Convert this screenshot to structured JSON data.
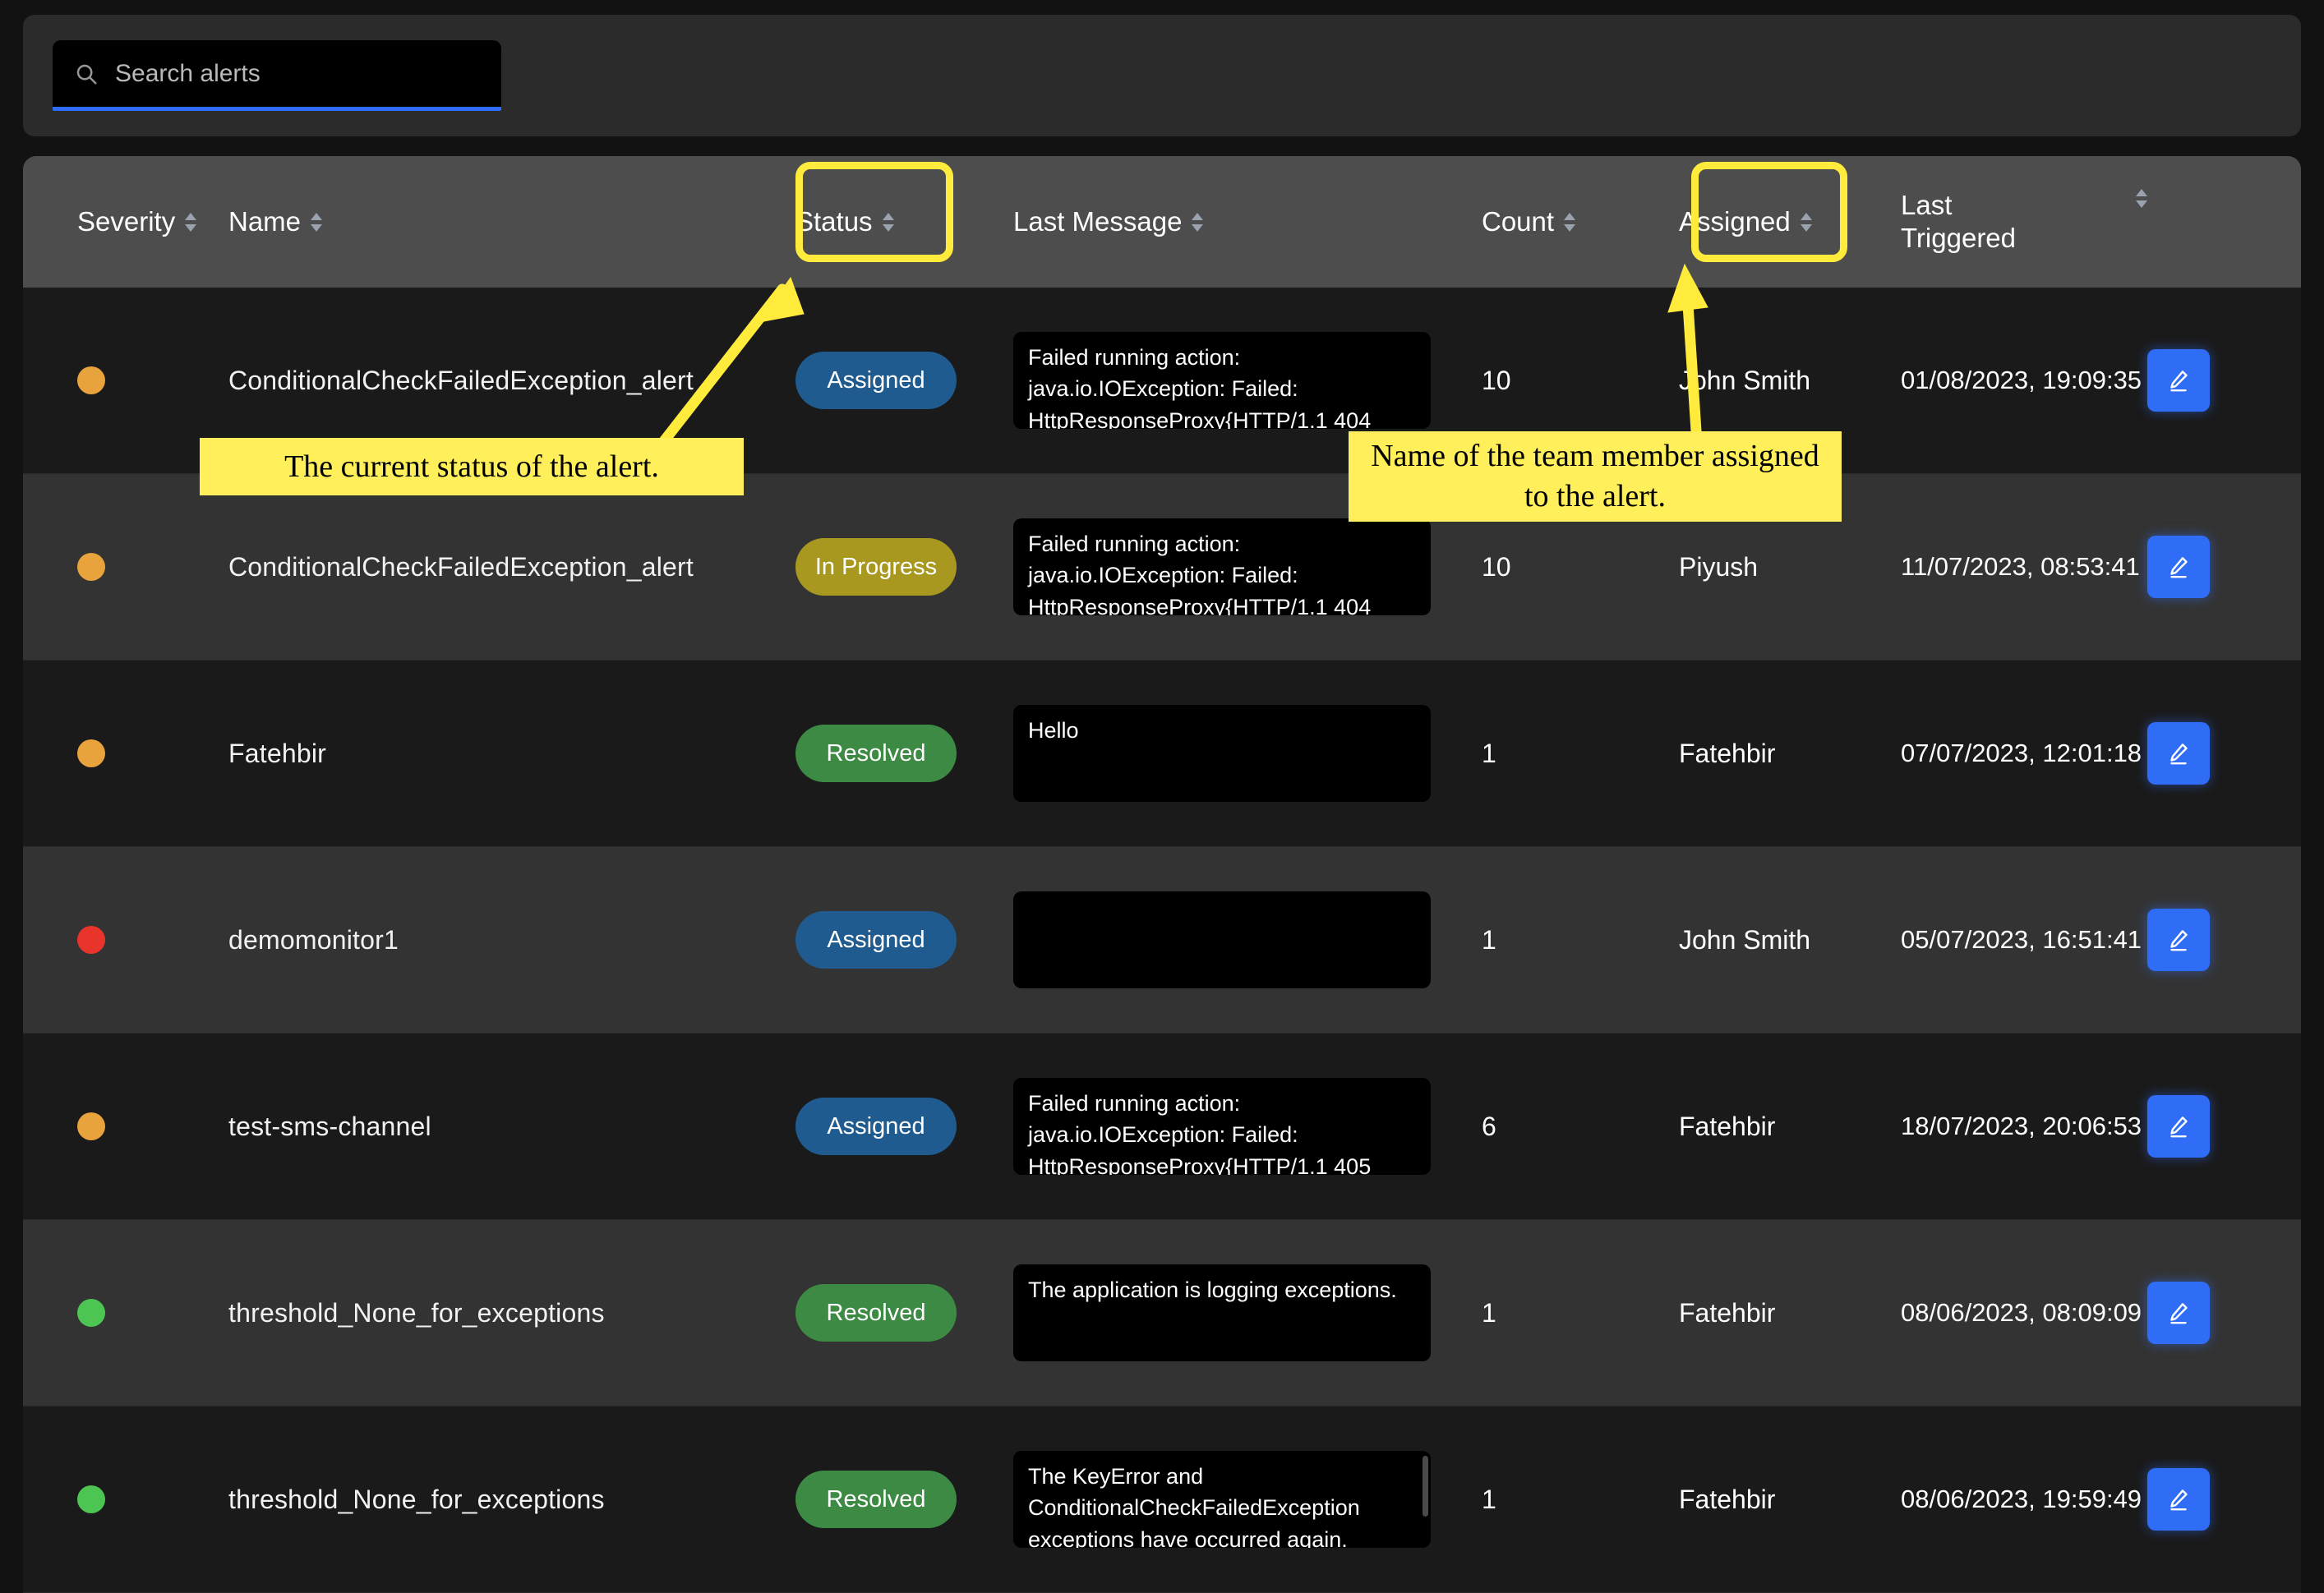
{
  "search": {
    "placeholder": "Search alerts",
    "value": "",
    "icon": "search-icon"
  },
  "table": {
    "columns": [
      {
        "key": "severity",
        "label": "Severity",
        "sortable": true
      },
      {
        "key": "name",
        "label": "Name",
        "sortable": true
      },
      {
        "key": "status",
        "label": "Status",
        "sortable": true
      },
      {
        "key": "message",
        "label": "Last Message",
        "sortable": true
      },
      {
        "key": "count",
        "label": "Count",
        "sortable": true
      },
      {
        "key": "assigned",
        "label": "Assigned",
        "sortable": true
      },
      {
        "key": "triggered",
        "label": "Last\nTriggered",
        "label_line1": "Last",
        "label_line2": "Triggered",
        "sortable": true
      },
      {
        "key": "actions",
        "label": "",
        "sortable": false
      }
    ],
    "rows": [
      {
        "severity_color": "#e8a33d",
        "severity_level": "warning",
        "name": "ConditionalCheckFailedException_alert",
        "status": "Assigned",
        "status_color": "#1f5b8f",
        "message": "Failed running action: java.io.IOException: Failed: HttpResponseProxy{HTTP/1.1 404",
        "message_scroll": true,
        "count": "10",
        "assigned": "John Smith",
        "triggered": "01/08/2023, 19:09:35",
        "action": "edit"
      },
      {
        "severity_color": "#e8a33d",
        "severity_level": "warning",
        "name": "ConditionalCheckFailedException_alert",
        "status": "In Progress",
        "status_color": "#a8981f",
        "message": "Failed running action: java.io.IOException: Failed: HttpResponseProxy{HTTP/1.1 404",
        "message_scroll": true,
        "count": "10",
        "assigned": "Piyush",
        "triggered": "11/07/2023, 08:53:41",
        "action": "edit"
      },
      {
        "severity_color": "#e8a33d",
        "severity_level": "warning",
        "name": "Fatehbir",
        "status": "Resolved",
        "status_color": "#3c8a43",
        "message": "Hello",
        "message_scroll": false,
        "count": "1",
        "assigned": "Fatehbir",
        "triggered": "07/07/2023, 12:01:18",
        "action": "edit"
      },
      {
        "severity_color": "#e8342a",
        "severity_level": "critical",
        "name": "demomonitor1",
        "status": "Assigned",
        "status_color": "#1f5b8f",
        "message": "",
        "message_scroll": false,
        "count": "1",
        "assigned": "John Smith",
        "triggered": "05/07/2023, 16:51:41",
        "action": "edit"
      },
      {
        "severity_color": "#e8a33d",
        "severity_level": "warning",
        "name": "test-sms-channel",
        "status": "Assigned",
        "status_color": "#1f5b8f",
        "message": "Failed running action: java.io.IOException: Failed: HttpResponseProxy{HTTP/1.1 405",
        "message_scroll": true,
        "count": "6",
        "assigned": "Fatehbir",
        "triggered": "18/07/2023, 20:06:53",
        "action": "edit"
      },
      {
        "severity_color": "#4cc councillor",
        "severity_level": "ok",
        "name": "threshold_None_for_exceptions",
        "status": "Resolved",
        "status_color": "#3c8a43",
        "message": "The application is logging exceptions.",
        "message_scroll": false,
        "count": "1",
        "assigned": "Fatehbir",
        "triggered": "08/06/2023, 08:09:09",
        "action": "edit"
      },
      {
        "severity_color": "#4cc552",
        "severity_level": "ok",
        "name": "threshold_None_for_exceptions",
        "status": "Resolved",
        "status_color": "#3c8a43",
        "message": "The KeyError and ConditionalCheckFailedException exceptions have occurred again.",
        "message_scroll": true,
        "count": "1",
        "assigned": "Fatehbir",
        "triggered": "08/06/2023, 19:59:49",
        "action": "edit"
      }
    ]
  },
  "annotations": [
    {
      "id": "status-note",
      "text": "The current status of the alert."
    },
    {
      "id": "assigned-note",
      "text": "Name of the team member assigned to the alert."
    }
  ],
  "colors": {
    "highlight": "#ffeb3b",
    "note_bg": "#ffef5a",
    "accent": "#2f6df6"
  }
}
